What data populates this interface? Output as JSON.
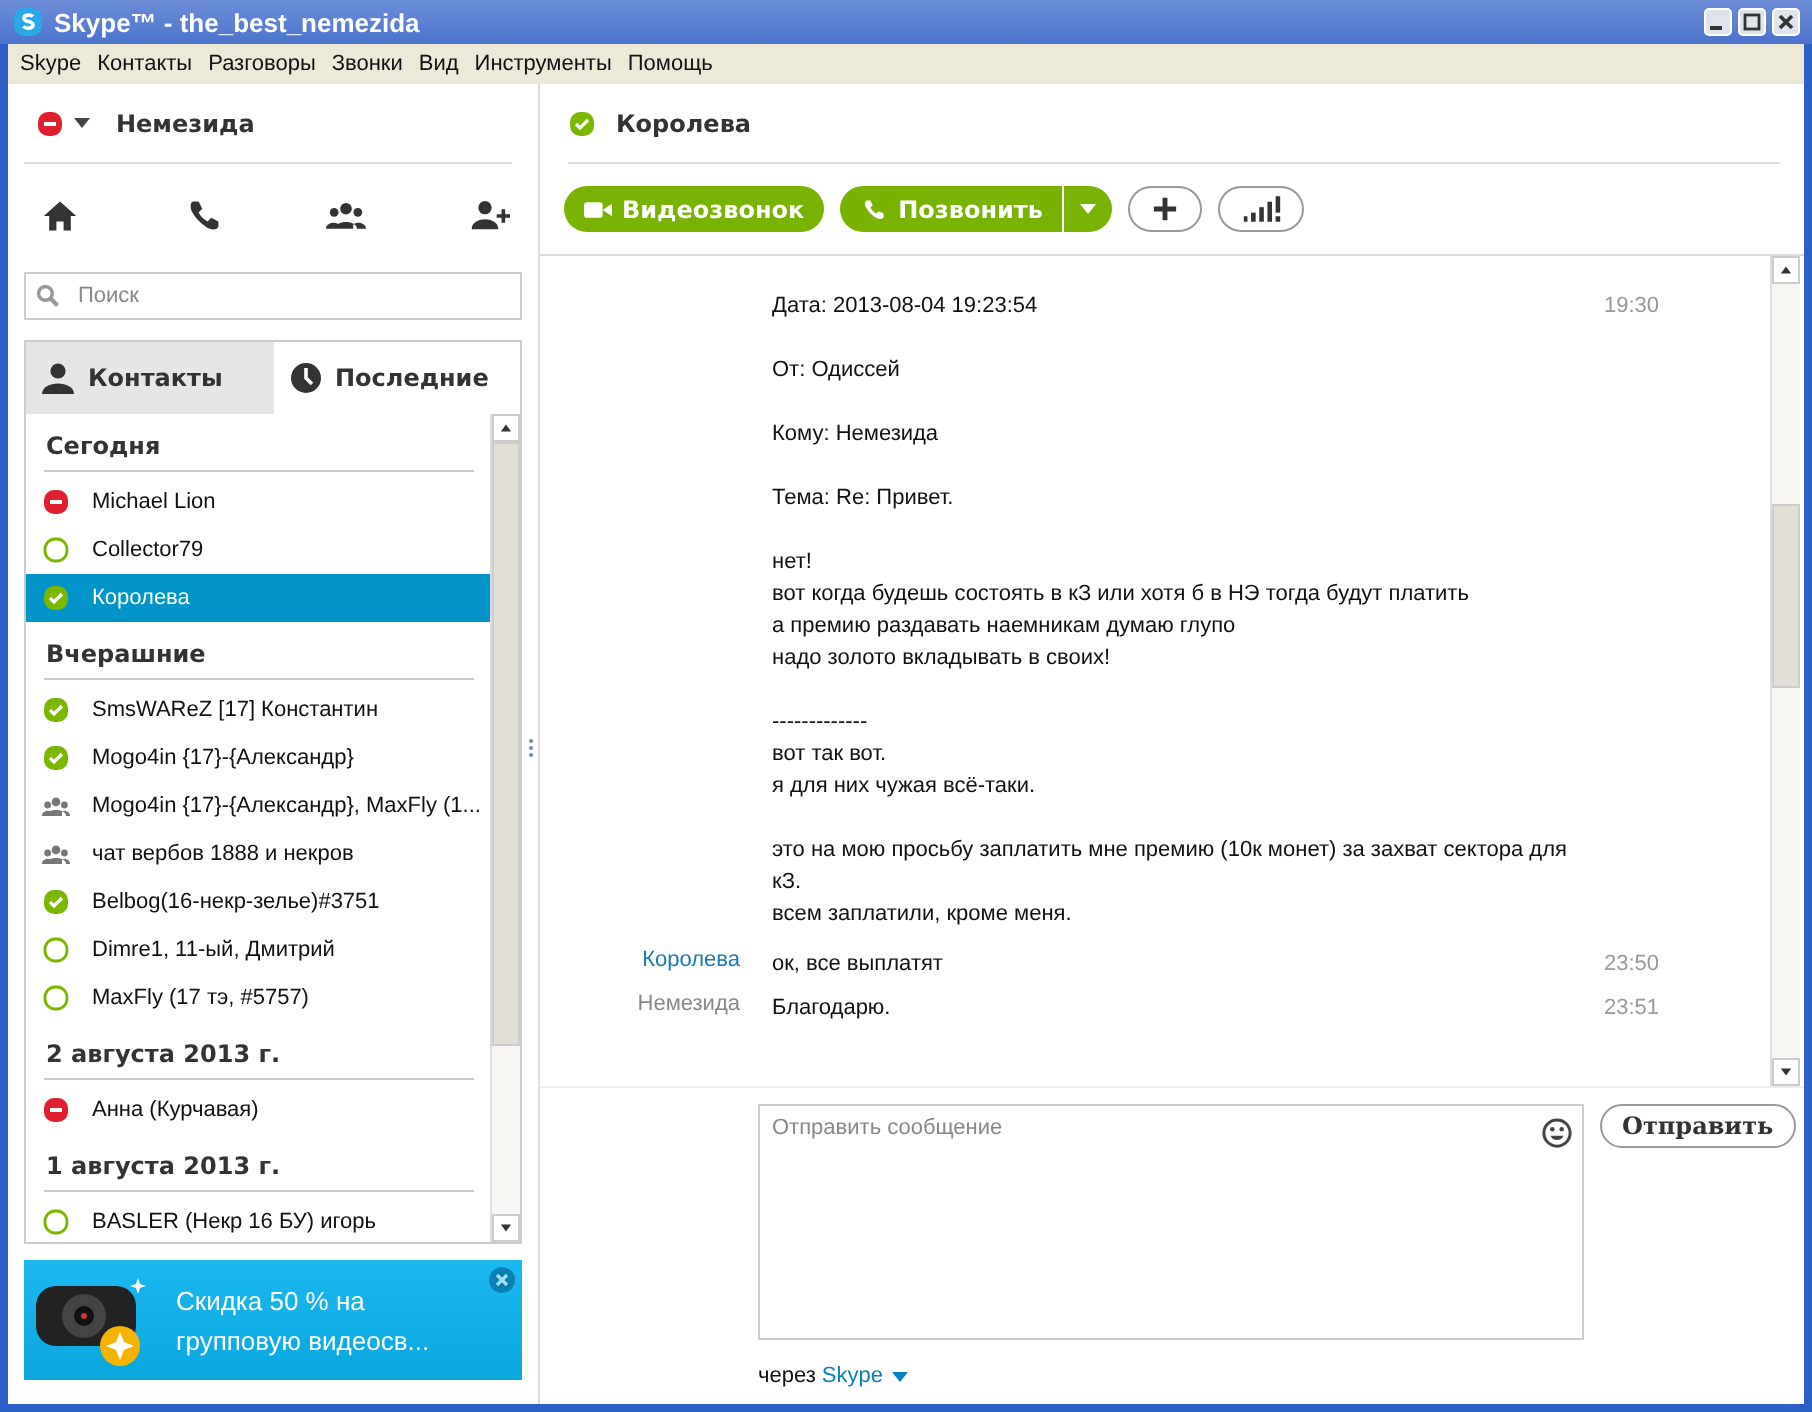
{
  "window": {
    "title": "Skype™ - the_best_nemezida"
  },
  "menu": [
    "Skype",
    "Контакты",
    "Разговоры",
    "Звонки",
    "Вид",
    "Инструменты",
    "Помощь"
  ],
  "profile": {
    "name": "Немезида",
    "kind": "busy"
  },
  "search": {
    "placeholder": "Поиск"
  },
  "tabs": [
    {
      "label": "Контакты",
      "kind": "person",
      "selected": false
    },
    {
      "label": "Последние",
      "kind": "clock",
      "selected": true
    }
  ],
  "groups": [
    {
      "title": "Сегодня",
      "items": [
        {
          "name": "Michael Lion",
          "kind": "busy",
          "selected": false
        },
        {
          "name": "Collector79",
          "kind": "offline",
          "selected": false
        },
        {
          "name": "Королева",
          "kind": "online",
          "selected": true
        }
      ]
    },
    {
      "title": "Вчерашние",
      "items": [
        {
          "name": "SmsWAReZ [17] Константин",
          "kind": "online",
          "selected": false
        },
        {
          "name": "Mogo4in {17}-{Александр}",
          "kind": "online",
          "selected": false
        },
        {
          "name": "Mogo4in {17}-{Александр}, MaxFly (1...",
          "kind": "group",
          "selected": false
        },
        {
          "name": "чат вербов 1888 и некров",
          "kind": "group",
          "selected": false
        },
        {
          "name": "Belbog(16-некр-зелье)#3751",
          "kind": "online",
          "selected": false
        },
        {
          "name": "Dimre1, 11-ый, Дмитрий",
          "kind": "offline",
          "selected": false
        },
        {
          "name": "MaxFly (17 тэ, #5757)",
          "kind": "offline",
          "selected": false
        }
      ]
    },
    {
      "title": "2 августа 2013 г.",
      "items": [
        {
          "name": "Анна (Курчавая)",
          "kind": "busy",
          "selected": false
        }
      ]
    },
    {
      "title": "1 августа 2013 г.",
      "items": [
        {
          "name": "BASLER (Некр 16 БУ) игорь",
          "kind": "offline",
          "selected": false
        }
      ]
    }
  ],
  "ad": {
    "lines": [
      "Скидка 50 % на",
      "групповую видеосв..."
    ]
  },
  "chat": {
    "contact": {
      "name": "Королева",
      "kind": "online"
    },
    "video_button": "Видеозвонок",
    "call_button": "Позвонить"
  },
  "messages": [
    {
      "kind": "quote",
      "time": "19:30",
      "paragraphs": [
        [
          "Дата: 2013-08-04 19:23:54"
        ],
        [
          "От: Одиссей"
        ],
        [
          "Кому: Немезида"
        ],
        [
          "Тема: Re: Привет."
        ],
        [
          "нет!",
          "вот когда будешь состоять в кЗ или хотя б в НЭ тогда будут платить",
          "а премию раздавать наемникам думаю глупо",
          "надо золото вкладывать в своих!"
        ],
        [
          "-------------",
          "вот так вот.",
          "я для них чужая всё-таки."
        ],
        [
          "это на мою просьбу заплатить мне премию (10к монет) за захват сектора для кЗ.",
          "всем заплатили, кроме меня."
        ]
      ]
    },
    {
      "kind": "incoming",
      "sender": "Королева",
      "time": "23:50",
      "paragraphs": [
        [
          "ок, все выплатят"
        ]
      ]
    },
    {
      "kind": "outgoing",
      "sender": "Немезида",
      "time": "23:51",
      "paragraphs": [
        [
          "Благодарю."
        ]
      ]
    }
  ],
  "composer": {
    "placeholder": "Отправить сообщение",
    "send": "Отправить",
    "via": "через",
    "via_link": "Skype"
  }
}
